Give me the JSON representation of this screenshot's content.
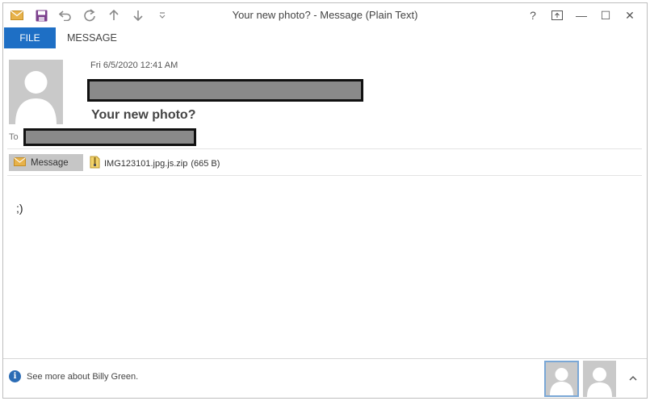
{
  "window": {
    "title": "Your new photo? - Message (Plain Text)",
    "help": "?",
    "minimize": "—",
    "maximize": "☐",
    "close": "✕"
  },
  "quick_access": [
    "envelope-icon",
    "save-icon",
    "undo-icon",
    "redo-icon",
    "up-icon",
    "down-icon",
    "customize-icon"
  ],
  "tabs": {
    "file": "FILE",
    "message": "MESSAGE"
  },
  "header": {
    "date": "Fri 6/5/2020 12:41 AM",
    "subject": "Your new photo?",
    "to_label": "To"
  },
  "attachments": {
    "message_tab": "Message",
    "file_name": "IMG123101.jpg.js.zip",
    "file_size": "(665 B)"
  },
  "body": {
    "text": ";)"
  },
  "people_pane": {
    "info": "See more about Billy Green."
  },
  "colors": {
    "accent": "#1e6fc5",
    "redaction": "#8a8a8a",
    "avatar": "#c9c9c9"
  }
}
